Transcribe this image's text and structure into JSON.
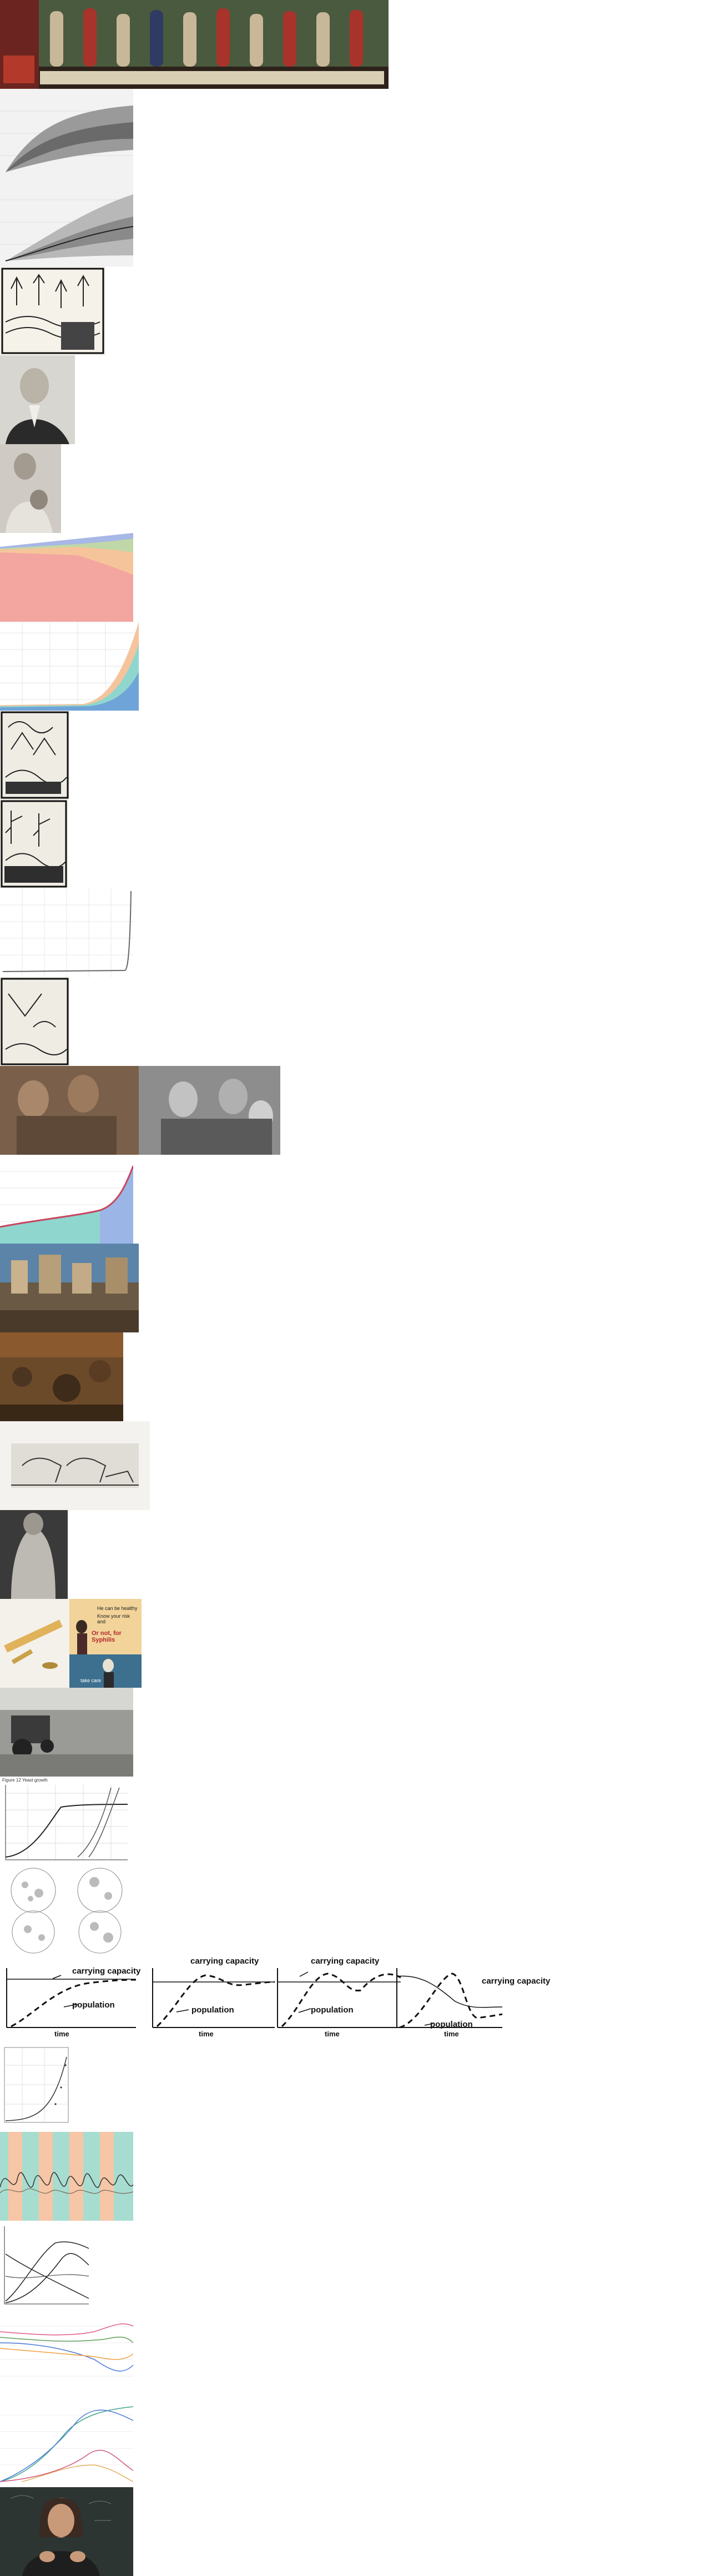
{
  "poster": {
    "headline": "Or not, for Syphilis",
    "line_a": "He can be healthy",
    "line_b": "Know your risk and",
    "line_c": "take care"
  },
  "logistic_panels": [
    {
      "carrying_capacity": "carrying capacity",
      "population": "population",
      "time": "time"
    },
    {
      "carrying_capacity": "carrying capacity",
      "population": "population",
      "time": "time"
    },
    {
      "carrying_capacity": "carrying capacity",
      "population": "population",
      "time": "time"
    },
    {
      "carrying_capacity": "carrying capacity",
      "population": "population",
      "time": "time"
    }
  ],
  "figure_caption": "Figure 12 Yeast growth",
  "colors": {
    "band_dark": "#5a5a5a",
    "band_light": "#c8c8c8",
    "stack_red": "#f3a6a0",
    "stack_orange": "#f6c49a",
    "stack_blue": "#9bb6e6",
    "line_area_teal": "#8fd6cf",
    "line_area_red": "#c8455e",
    "cycle_orange": "#f6c6a6",
    "cycle_teal": "#a7ddd0"
  }
}
